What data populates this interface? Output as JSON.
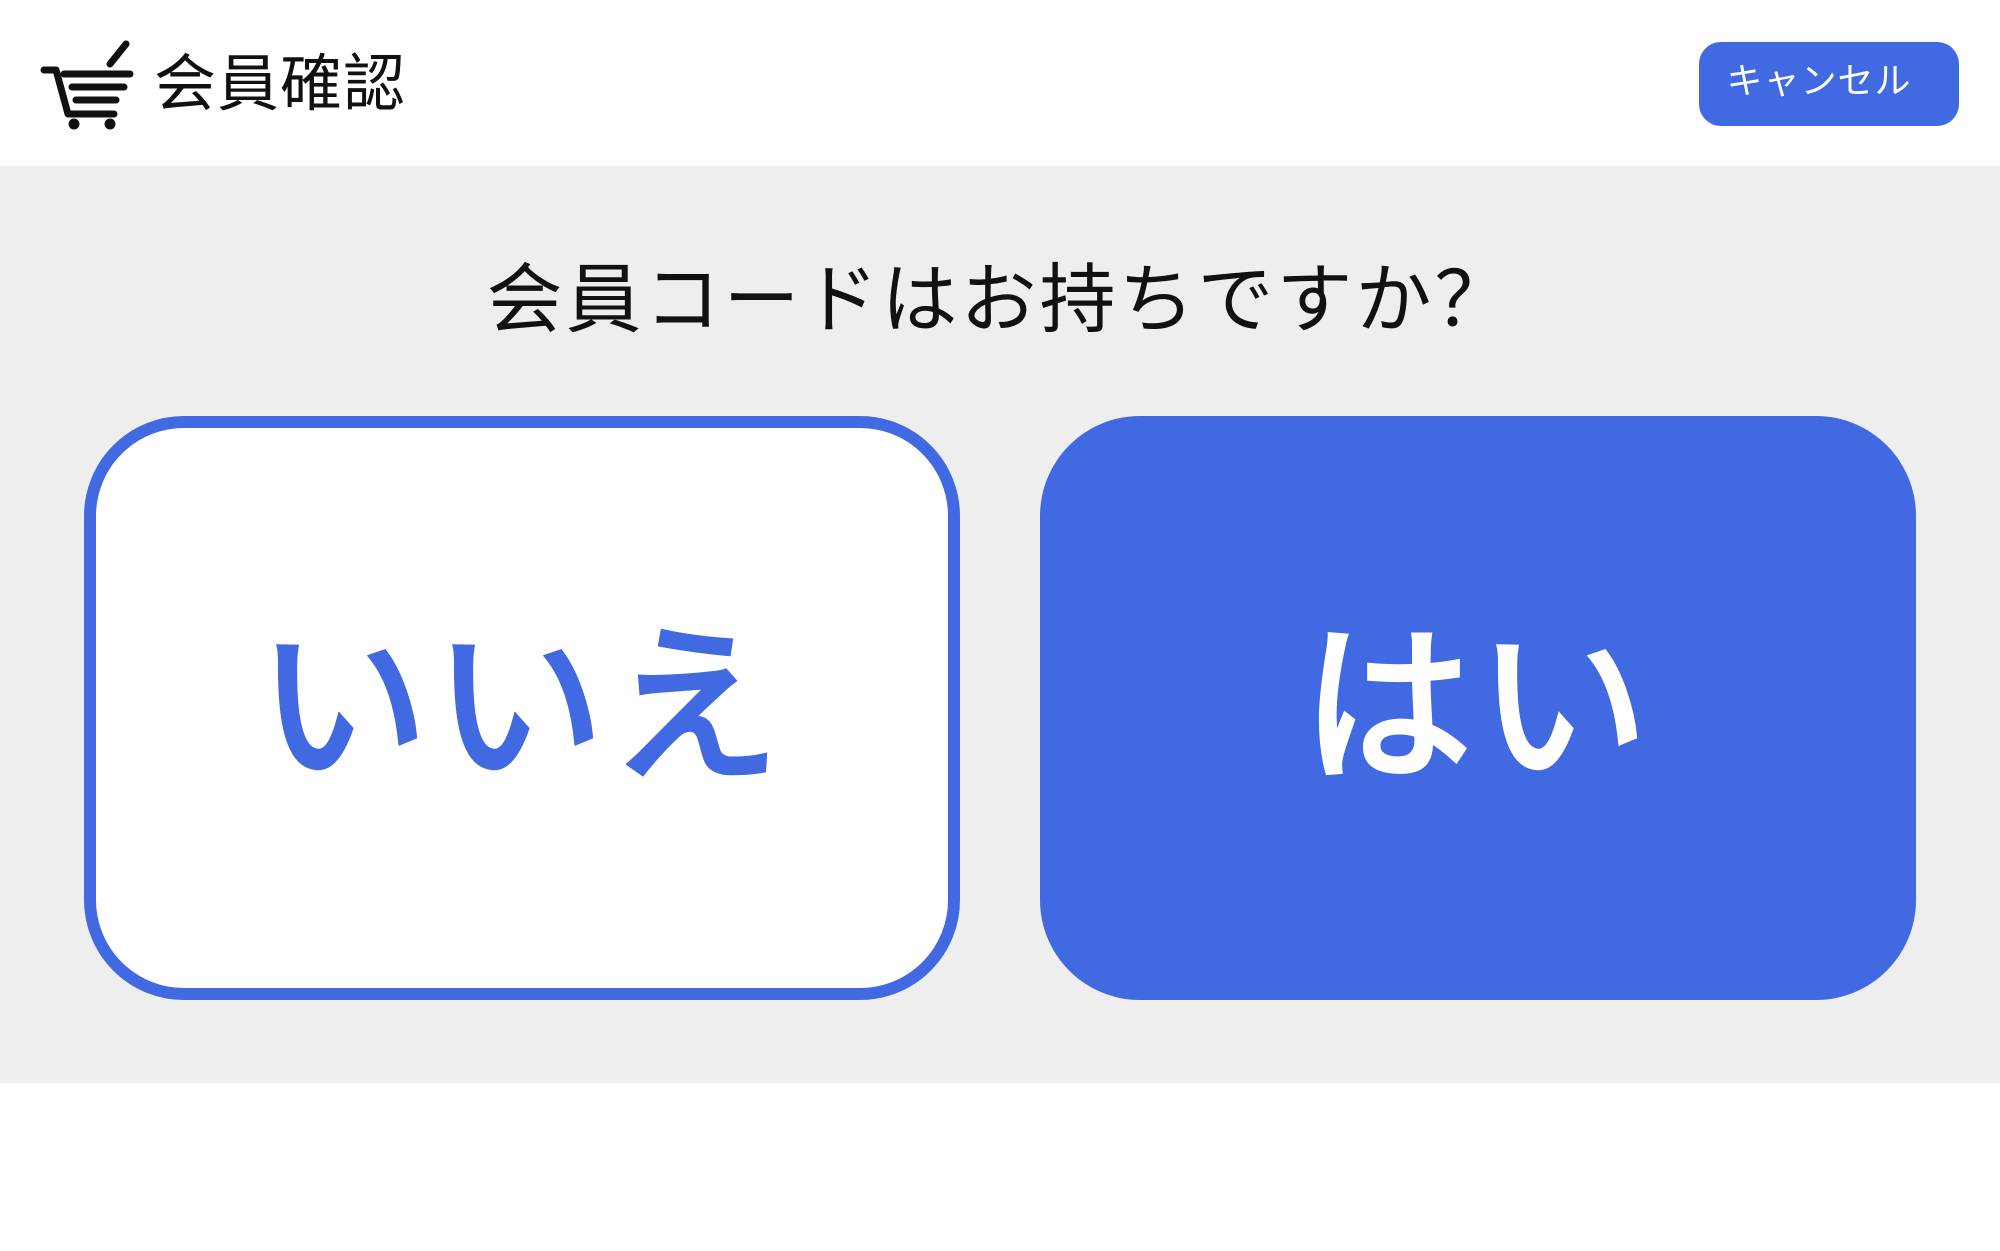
{
  "header": {
    "icon": "shopping-cart-icon",
    "title": "会員確認",
    "cancel_label": "キャンセル"
  },
  "main": {
    "question": "会員コードはお持ちですか？",
    "choices": [
      {
        "label": "いいえ",
        "style": "outline"
      },
      {
        "label": "はい",
        "style": "filled"
      }
    ]
  },
  "colors": {
    "accent": "#4169e1",
    "panel_background": "#eeeeee",
    "text": "#111111",
    "background": "#ffffff"
  }
}
